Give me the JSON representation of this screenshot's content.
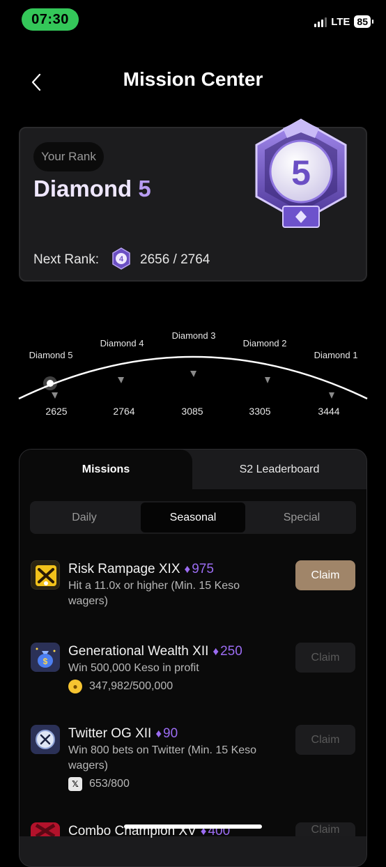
{
  "status_bar": {
    "time": "07:30",
    "network": "LTE",
    "battery": "85"
  },
  "header": {
    "title": "Mission Center"
  },
  "rank_card": {
    "pill": "Your Rank",
    "rank_tier": "Diamond",
    "rank_level": "5",
    "next_rank_label": "Next Rank:",
    "next_rank_badge_level": "4",
    "progress_text": "2656 / 2764",
    "badge_number": "5"
  },
  "rank_track": [
    {
      "name": "Diamond 5",
      "value": "2625"
    },
    {
      "name": "Diamond 4",
      "value": "2764"
    },
    {
      "name": "Diamond 3",
      "value": "3085"
    },
    {
      "name": "Diamond 2",
      "value": "3305"
    },
    {
      "name": "Diamond 1",
      "value": "3444"
    }
  ],
  "tabs": {
    "missions": "Missions",
    "leaderboard": "S2 Leaderboard"
  },
  "segments": {
    "daily": "Daily",
    "seasonal": "Seasonal",
    "special": "Special",
    "selected": "Seasonal"
  },
  "missions": [
    {
      "title": "Risk Rampage XIX",
      "points": "975",
      "desc": "Hit a 11.0x or higher (Min. 15 Keso wagers)",
      "progress": "",
      "claim": "Claim",
      "claim_enabled": true,
      "icon": "crossed-bats-icon"
    },
    {
      "title": "Generational Wealth XII",
      "points": "250",
      "desc": "Win 500,000 Keso in profit",
      "progress": "347,982/500,000",
      "claim": "Claim",
      "claim_enabled": false,
      "icon": "money-bag-icon"
    },
    {
      "title": "Twitter OG XII",
      "points": "90",
      "desc": "Win 800 bets on Twitter (Min. 15 Keso wagers)",
      "progress": "653/800",
      "claim": "Claim",
      "claim_enabled": false,
      "icon": "x-logo-icon"
    },
    {
      "title": "Combo Champion XV",
      "points": "400",
      "claim": "Claim",
      "claim_enabled": false,
      "icon": "combo-icon"
    }
  ],
  "colors": {
    "accent_purple": "#9b6cf2",
    "claim_active": "#a08569",
    "status_green": "#34c759"
  }
}
